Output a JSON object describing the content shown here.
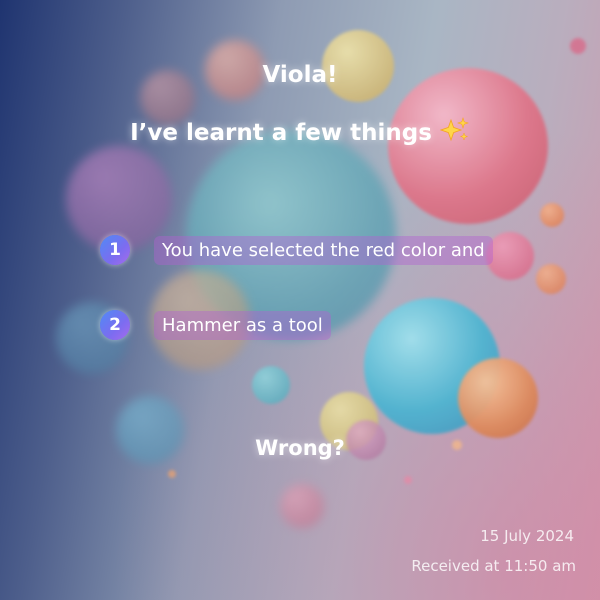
{
  "header": {
    "title": "Viola!",
    "subtitle": "I’ve learnt a few things"
  },
  "steps": [
    {
      "number": "1",
      "text": "You have selected the red color and"
    },
    {
      "number": "2",
      "text": "Hammer as a tool"
    }
  ],
  "question": "Wrong?",
  "meta": {
    "date": "15 July 2024",
    "received": "Received at 11:50 am"
  },
  "icons": {
    "sparkle": "sparkles-icon"
  },
  "colors": {
    "accent_badge": "#6f7cf2",
    "highlight": "#b260d2",
    "text": "#ffffff"
  }
}
